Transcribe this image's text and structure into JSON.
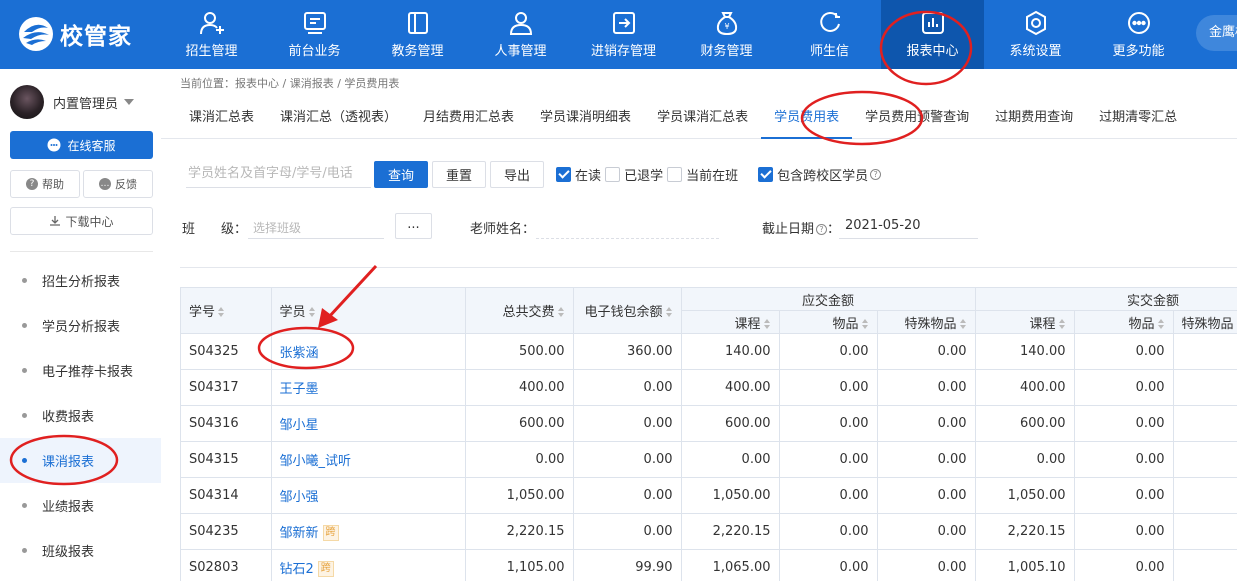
{
  "app": {
    "logo_text": "校管家",
    "company_label": "金鹰桂"
  },
  "nav": [
    {
      "label": "招生管理",
      "icon": "add-person-icon"
    },
    {
      "label": "前台业务",
      "icon": "monitor-icon"
    },
    {
      "label": "教务管理",
      "icon": "book-icon"
    },
    {
      "label": "人事管理",
      "icon": "person-icon"
    },
    {
      "label": "进销存管理",
      "icon": "inventory-icon"
    },
    {
      "label": "财务管理",
      "icon": "money-bag-icon"
    },
    {
      "label": "师生信",
      "icon": "chat-icon"
    },
    {
      "label": "报表中心",
      "icon": "report-icon"
    },
    {
      "label": "系统设置",
      "icon": "settings-icon"
    },
    {
      "label": "更多功能",
      "icon": "more-icon"
    }
  ],
  "sidebar": {
    "user_name": "内置管理员",
    "service_label": "在线客服",
    "help_label": "帮助",
    "feedback_label": "反馈",
    "download_label": "下载中心",
    "menu": [
      "招生分析报表",
      "学员分析报表",
      "电子推荐卡报表",
      "收费报表",
      "课消报表",
      "业绩报表",
      "班级报表"
    ],
    "active_menu": 4
  },
  "breadcrumb": "当前位置：报表中心 / 课消报表 / 学员费用表",
  "tabs": [
    "课消汇总表",
    "课消汇总（透视表）",
    "月结费用汇总表",
    "学员课消明细表",
    "学员课消汇总表",
    "学员费用表",
    "学员费用预警查询",
    "过期费用查询",
    "过期清零汇总"
  ],
  "active_tab": 5,
  "filters": {
    "search_placeholder": "学员姓名及首字母/学号/电话",
    "query_label": "查询",
    "reset_label": "重置",
    "export_label": "导出",
    "checkboxes": [
      {
        "label": "在读",
        "checked": true
      },
      {
        "label": "已退学",
        "checked": false
      },
      {
        "label": "当前在班",
        "checked": false
      },
      {
        "label": "包含跨校区学员",
        "checked": true
      }
    ],
    "class_label": "班　　级：",
    "class_placeholder": "选择班级",
    "class_picker_label": "...",
    "teacher_label": "老师姓名：",
    "teacher_value": "",
    "deadline_label": "截止日期",
    "deadline_colon": "：",
    "deadline_value": "2021-05-20"
  },
  "table": {
    "headers": {
      "student_no": "学号",
      "student": "学员",
      "total_paid": "总共交费",
      "wallet_balance": "电子钱包余额",
      "due_group": "应交金额",
      "paid_group": "实交金额",
      "course": "课程",
      "goods": "物品",
      "special_goods": "特殊物品"
    },
    "cross_tag": "跨",
    "rows": [
      {
        "no": "S04325",
        "name": "张紫涵",
        "cross": false,
        "total": "500.00",
        "wallet": "360.00",
        "due_course": "140.00",
        "due_goods": "0.00",
        "due_special": "0.00",
        "paid_course": "140.00",
        "paid_goods": "0.00"
      },
      {
        "no": "S04317",
        "name": "王子墨",
        "cross": false,
        "total": "400.00",
        "wallet": "0.00",
        "due_course": "400.00",
        "due_goods": "0.00",
        "due_special": "0.00",
        "paid_course": "400.00",
        "paid_goods": "0.00"
      },
      {
        "no": "S04316",
        "name": "邹小星",
        "cross": false,
        "total": "600.00",
        "wallet": "0.00",
        "due_course": "600.00",
        "due_goods": "0.00",
        "due_special": "0.00",
        "paid_course": "600.00",
        "paid_goods": "0.00"
      },
      {
        "no": "S04315",
        "name": "邹小曦_试听",
        "cross": false,
        "total": "0.00",
        "wallet": "0.00",
        "due_course": "0.00",
        "due_goods": "0.00",
        "due_special": "0.00",
        "paid_course": "0.00",
        "paid_goods": "0.00"
      },
      {
        "no": "S04314",
        "name": "邹小强",
        "cross": false,
        "total": "1,050.00",
        "wallet": "0.00",
        "due_course": "1,050.00",
        "due_goods": "0.00",
        "due_special": "0.00",
        "paid_course": "1,050.00",
        "paid_goods": "0.00"
      },
      {
        "no": "S04235",
        "name": "邹新新",
        "cross": true,
        "total": "2,220.15",
        "wallet": "0.00",
        "due_course": "2,220.15",
        "due_goods": "0.00",
        "due_special": "0.00",
        "paid_course": "2,220.15",
        "paid_goods": "0.00"
      },
      {
        "no": "S02803",
        "name": "钻石2",
        "cross": true,
        "total": "1,105.00",
        "wallet": "99.90",
        "due_course": "1,065.00",
        "due_goods": "0.00",
        "due_special": "0.00",
        "paid_course": "1,005.10",
        "paid_goods": "0.00"
      }
    ]
  },
  "colors": {
    "primary": "#1b6fd4",
    "annotation": "#e02020"
  }
}
